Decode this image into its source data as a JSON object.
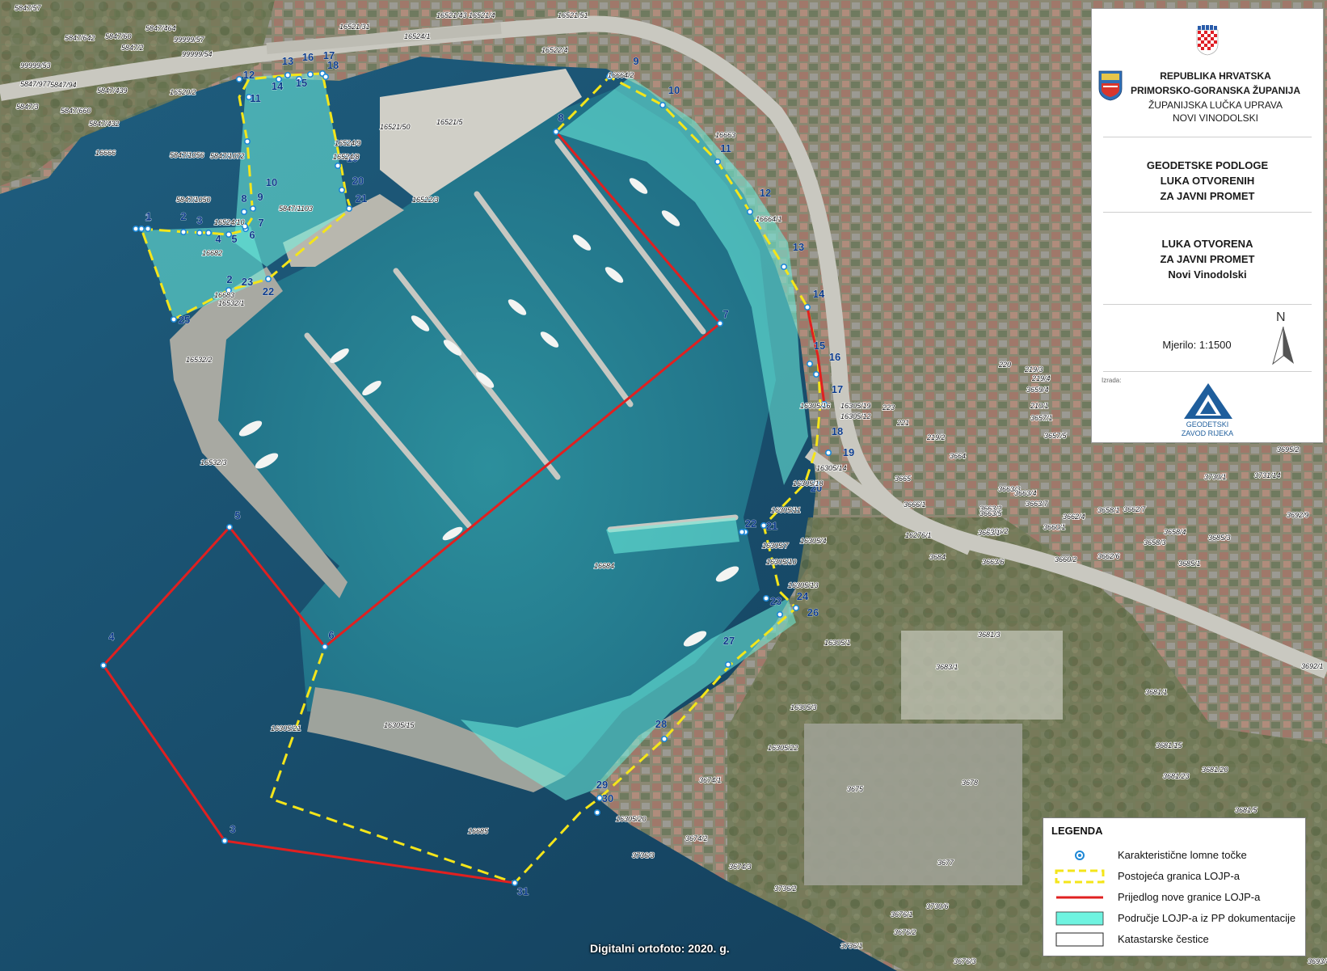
{
  "header": {
    "line1": "REPUBLIKA HRVATSKA",
    "line2": "PRIMORSKO-GORANSKA ŽUPANIJA",
    "line3": "ŽUPANIJSKA LUČKA UPRAVA",
    "line4": "NOVI VINODOLSKI"
  },
  "title_block": {
    "title1": "GEODETSKE PODLOGE",
    "title2": "LUKA OTVORENIH",
    "title3": "ZA JAVNI PROMET",
    "subtitle1": "LUKA OTVORENA",
    "subtitle2": "ZA JAVNI PROMET",
    "subtitle3": "Novi Vinodolski",
    "scale": "Mjerilo: 1:1500",
    "north": "N",
    "made_by": "Izrada:",
    "company1": "GEODETSKI",
    "company2": "ZAVOD RIJEKA"
  },
  "legend": {
    "title": "LEGENDA",
    "items": [
      "Karakteristične lomne točke",
      "Postojeća granica LOJP-a",
      "Prijedlog nove granice LOJP-a",
      "Područje LOJP-a iz PP dokumentacije",
      "Katastarske čestice"
    ]
  },
  "footer": {
    "ortho": "Digitalni ortofoto: 2020. g."
  },
  "colors": {
    "sea_deep": "#1d5878",
    "sea_harbor": "#2f8d9a",
    "zone_fill": "#6ff3e0",
    "proposed_boundary": "#e02020",
    "existing_boundary": "#f4e51a",
    "point_marker": "#1e88d6",
    "point_label": "#0b3a8a",
    "land": "#8a8d72"
  },
  "icons": [
    "croatian-coat-of-arms-icon",
    "county-coat-of-arms-icon",
    "north-arrow-icon",
    "gzr-logo-icon"
  ],
  "map": {
    "point_labels": [
      "1",
      "2",
      "3",
      "4",
      "5",
      "6",
      "7",
      "8",
      "9",
      "10",
      "11",
      "12",
      "13",
      "14",
      "15",
      "16",
      "17",
      "18",
      "19",
      "20",
      "21",
      "22",
      "23",
      "24",
      "25",
      "26",
      "27",
      "28",
      "29",
      "30",
      "31",
      "32",
      "33"
    ],
    "parcel_labels": [
      "5847/57",
      "5847/642",
      "5847/2",
      "5847/60",
      "5847/464",
      "99999/57",
      "99999/54",
      "99999/53",
      "5847/977",
      "5847/94",
      "5847/439",
      "5847/3",
      "5847/660",
      "5847/432",
      "16666",
      "16521/43",
      "16521/31",
      "16521/51",
      "16522/4",
      "16521/4",
      "16520/2",
      "16521/50",
      "16521/5",
      "16524/1",
      "16524/9",
      "16524/8",
      "16522/3",
      "16664/2",
      "16663",
      "16664/1",
      "5847/1056",
      "5847/1072",
      "5847/1050",
      "5847/1103",
      "16524/10",
      "16682",
      "16683",
      "16532/1",
      "16532/2",
      "16532/3",
      "16684",
      "16685",
      "16305/21",
      "16305/15",
      "16305/20",
      "16305/22",
      "16305/1",
      "16305/3",
      "16305/4",
      "16305/7",
      "16305/10",
      "16305/11",
      "16305/13",
      "16305/14",
      "16305/16",
      "16305/18",
      "16305/19",
      "16305/12",
      "3674/1",
      "3674/2",
      "3674/3",
      "3736/2",
      "3736/3",
      "3736/1",
      "3676/1",
      "3676/2",
      "3676/3",
      "3730/6",
      "3675",
      "3678",
      "3677",
      "3681/1",
      "3681/15",
      "3681/5",
      "3681/19",
      "3681/23",
      "3681/20",
      "3685/1",
      "3685/3",
      "3683/1",
      "3681/3",
      "3684",
      "3665",
      "3664",
      "3666/1",
      "3666/2",
      "16276/1",
      "3663/1",
      "3663/2",
      "3663/3",
      "3663/4",
      "3663/5",
      "3663/6",
      "3663/7",
      "3660/1",
      "3660/2",
      "3662/4",
      "3662/6",
      "3662/7",
      "3658/1",
      "3658/3",
      "3658/4",
      "3692/9",
      "3692/1",
      "3693/4",
      "3695/2",
      "3730/1",
      "3731/14",
      "3657/1",
      "3657/5",
      "3659/4",
      "210/1",
      "219/2",
      "219/3",
      "219/4",
      "220",
      "221",
      "223",
      "224",
      "225",
      "226",
      "227"
    ]
  }
}
